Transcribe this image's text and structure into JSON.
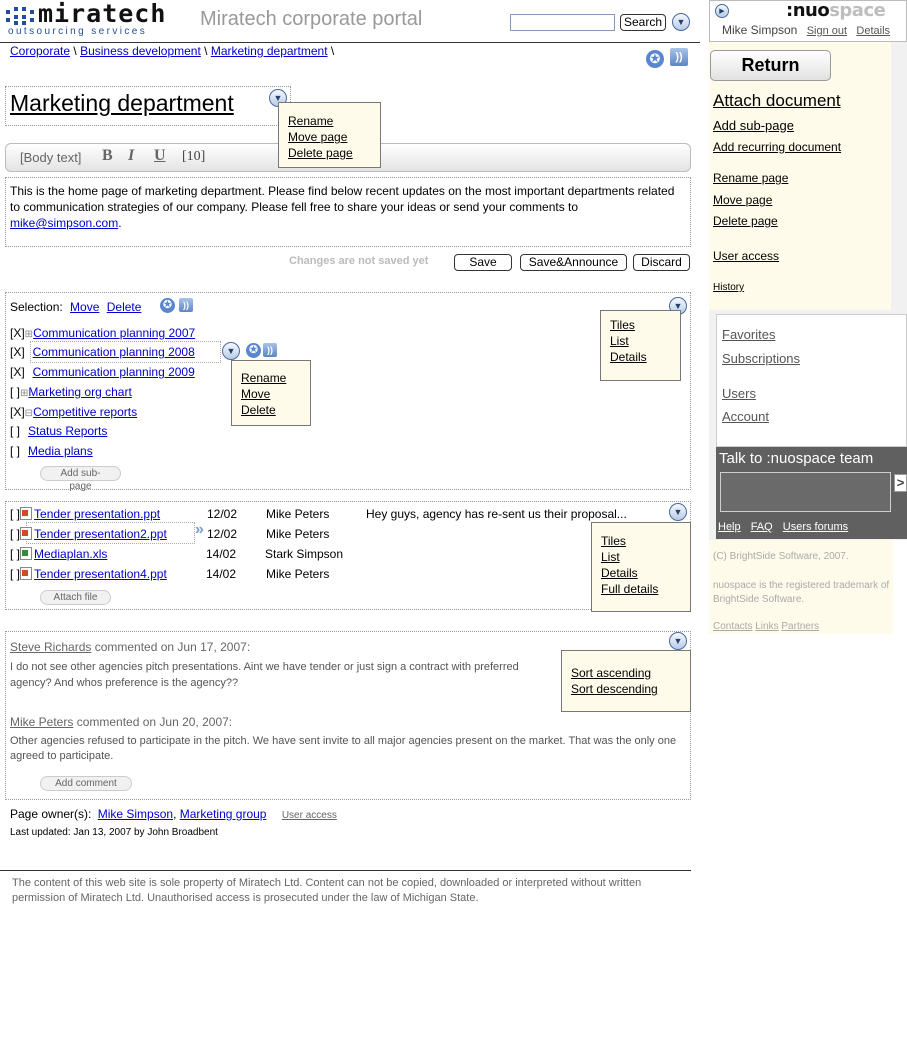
{
  "header": {
    "logo_name": "miratech",
    "logo_tagline": "outsourcing services",
    "portal_title": "Miratech corporate portal",
    "search_placeholder": "",
    "search_button": "Search"
  },
  "breadcrumb": [
    "Coroporate",
    "Business development",
    "Marketing department"
  ],
  "page": {
    "title": "Marketing department",
    "title_menu": [
      "Rename",
      "Move page",
      "Delete page"
    ],
    "toolbar": {
      "style": "[Body text]",
      "bold": "B",
      "italic": "I",
      "underline": "U",
      "size": "[10]"
    },
    "body_text": "This is the home page of marketing department. Please find below recent updates on the most important departments related to communication strategies of our company. Please fell free to share your ideas or send your comments to",
    "body_email": " mike@simpson.com",
    "unsaved_text": "Changes are not saved yet",
    "save": "Save",
    "save_announce": "Save&Announce",
    "discard": "Discard"
  },
  "subpages": {
    "selection_label": "Selection:",
    "move": "Move",
    "delete": "Delete",
    "items": [
      {
        "check": "[X]",
        "expander": "⊞",
        "label": "Communication planning 2007"
      },
      {
        "check": "[X]",
        "expander": "",
        "label": "Communication planning 2008"
      },
      {
        "check": "[X]",
        "expander": "",
        "label": "Communication planning 2009"
      },
      {
        "check": "[ ]",
        "expander": "⊞",
        "label": "Marketing org chart"
      },
      {
        "check": "[X]",
        "expander": "⊟",
        "label": "Competitive reports"
      },
      {
        "check": "[ ]",
        "expander": "",
        "label": "Status Reports"
      },
      {
        "check": "[ ]",
        "expander": "",
        "label": "Media plans"
      }
    ],
    "item_menu": [
      "Rename",
      "Move",
      "Delete"
    ],
    "view_menu": [
      "Tiles",
      "List",
      "Details"
    ],
    "add_subpage": "Add sub-page"
  },
  "files": {
    "items": [
      {
        "check": "[ ]",
        "icon": "ppt-icon",
        "name": "Tender presentation.ppt",
        "date": "12/02",
        "author": "Mike Peters",
        "comment": "Hey guys, agency has re-sent us their proposal..."
      },
      {
        "check": "[ ]",
        "icon": "ppt-icon",
        "name": "Tender presentation2.ppt",
        "date": "12/02",
        "author": "Mike Peters",
        "comment": ""
      },
      {
        "check": "[ ]",
        "icon": "xls-icon",
        "name": "Mediaplan.xls",
        "date": "14/02",
        "author": "Stark Simpson",
        "comment": ""
      },
      {
        "check": "[ ]",
        "icon": "ppt-icon",
        "name": "Tender presentation4.ppt",
        "date": "14/02",
        "author": "Mike Peters",
        "comment": ""
      }
    ],
    "view_menu": [
      "Tiles",
      "List",
      "Details",
      "Full details"
    ],
    "attach_file": "Attach file"
  },
  "comments": {
    "items": [
      {
        "author": "Steve Richards",
        "meta": " commented on Jun 17, 2007:",
        "text": "I do not see other agencies pitch presentations. Aint we have tender or just sign a contract with preferred agency? And whos preference is the agency??"
      },
      {
        "author": "Mike Peters",
        "meta": " commented on Jun 20, 2007:",
        "text": "Other agencies refused to participate in the pitch. We have sent invite to all major agencies present on the market. That was the only one agreed to participate."
      }
    ],
    "sort_menu": [
      "Sort ascending",
      "Sort descending"
    ],
    "add_comment": "Add comment"
  },
  "owner": {
    "label": "Page owner(s):",
    "owner1": "Mike Simpson",
    "owner2": "Marketing group",
    "user_access": "User access",
    "last_updated": "Last updated: Jan 13, 2007 by John Broadbent"
  },
  "footer": {
    "text": "The content of this web site is sole property of Miratech Ltd. Content can not be copied, downloaded or interpreted without written permission of Miratech Ltd. Unauthorised access is prosecuted under the law of Michigan State."
  },
  "sidebar": {
    "brand_bold": ":nuo",
    "brand_light": "space",
    "user": "Mike Simpson",
    "sign_out": "Sign out",
    "details": "Details",
    "return": "Return",
    "attach_document": "Attach document",
    "links1": [
      "Add sub-page",
      "Add recurring document"
    ],
    "links2": [
      "Rename page",
      "Move page",
      "Delete page"
    ],
    "user_access": "User access",
    "history": "History",
    "links3": [
      "Favorites",
      "Subscriptions"
    ],
    "links4": [
      "Users",
      "Account"
    ],
    "talk_title": "Talk to :nuospace team",
    "talk_send": ">",
    "talk_links": [
      "Help",
      "FAQ",
      "Users forums"
    ],
    "copyright": "(C) BrightSide Software, 2007.",
    "trademark": "nuospace is the registered trademark of BrightSide Software.",
    "bottom_links": [
      "Contacts",
      "Links",
      "Partners"
    ]
  }
}
